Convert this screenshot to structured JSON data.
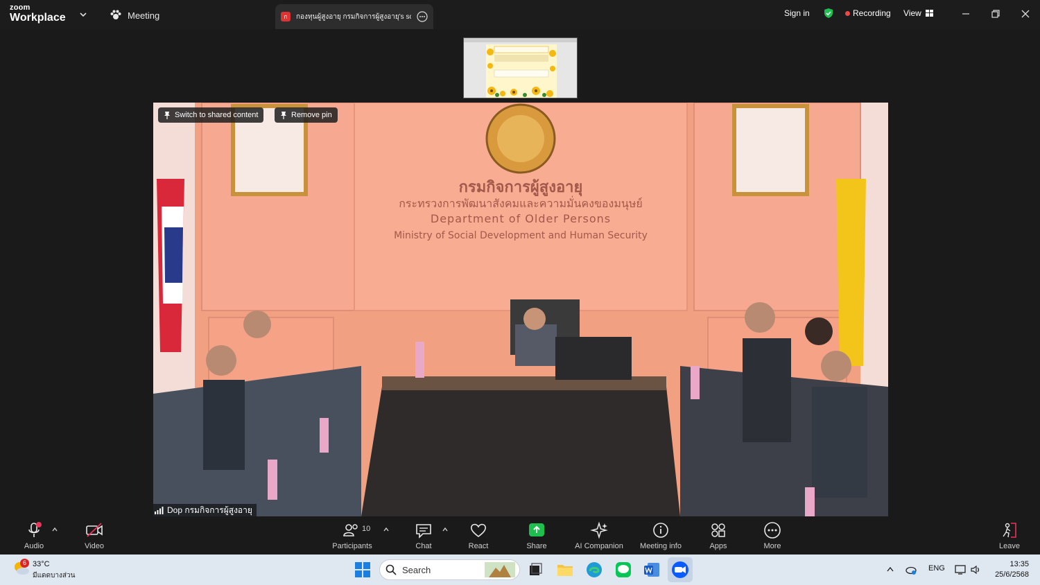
{
  "brand": {
    "line1": "zoom",
    "line2": "Workplace"
  },
  "tabs": {
    "meeting": "Meeting",
    "share_badge": "ก",
    "share_title": "กองทุนผู้สูงอายุ กรมกิจการผู้สูงอายุ's sc"
  },
  "header": {
    "sign_in": "Sign in",
    "recording": "Recording",
    "view": "View"
  },
  "video": {
    "switch_label": "Switch to shared content",
    "remove_pin_label": "Remove pin",
    "participant_name": "Dop กรมกิจการผู้สูงอายุ",
    "wall": {
      "line1": "กรมกิจการผู้สูงอายุ",
      "line2": "กระทรวงการพัฒนาสังคมและความมั่นคงของมนุษย์",
      "line3": "Department of Older Persons",
      "line4": "Ministry of Social Development and Human Security"
    }
  },
  "toolbar": {
    "audio": "Audio",
    "video": "Video",
    "participants": "Participants",
    "participants_count": "10",
    "chat": "Chat",
    "react": "React",
    "share": "Share",
    "ai_companion": "AI Companion",
    "meeting_info": "Meeting info",
    "apps": "Apps",
    "more": "More",
    "leave": "Leave"
  },
  "taskbar": {
    "weather_badge": "6",
    "temperature": "33°C",
    "weather_desc": "มีแดดบางส่วน",
    "search_placeholder": "Search",
    "language": "ENG",
    "time": "13:35",
    "date": "25/6/2568"
  },
  "colors": {
    "accent_green": "#1fbf4f",
    "record_red": "#f04848",
    "zoom_blue": "#0b5cff",
    "bar_bg": "#1a1a1a"
  }
}
